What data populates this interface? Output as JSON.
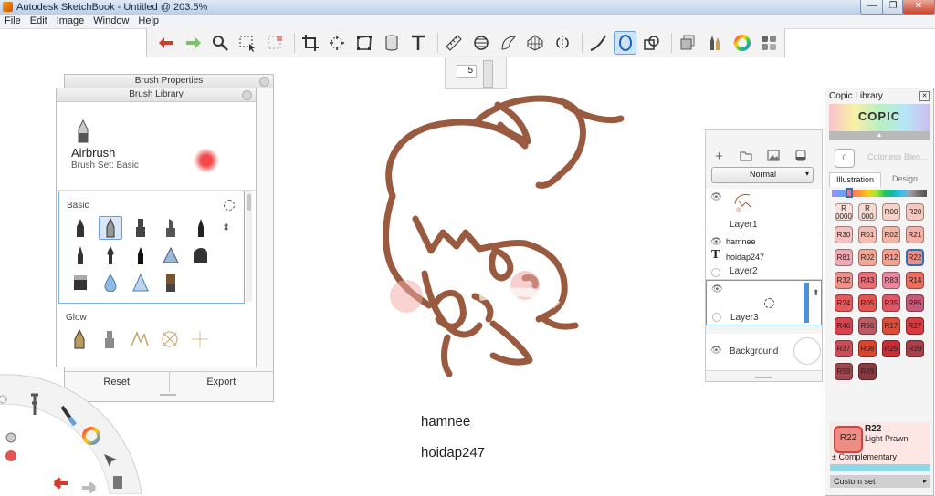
{
  "window": {
    "title": "Autodesk SketchBook - Untitled @ 203.5%",
    "minimize": "—",
    "maximize": "❐",
    "close": "✕"
  },
  "menu": [
    "File",
    "Edit",
    "Image",
    "Window",
    "Help"
  ],
  "toolbar": {
    "brush_size": "5"
  },
  "brush_properties": {
    "title": "Brush Properties",
    "reset_label": "Reset",
    "export_label": "Export"
  },
  "brush_library": {
    "title": "Brush Library",
    "current_brush": "Airbrush",
    "brush_set": "Brush Set: Basic",
    "section_basic": "Basic",
    "section_glow": "Glow"
  },
  "layers": {
    "blend_mode": "Normal",
    "items": [
      {
        "name": "Layer1"
      },
      {
        "name": "Layer2",
        "text_lines": [
          "hamnee",
          "hoidap247"
        ]
      },
      {
        "name": "Layer3"
      },
      {
        "name": "Background"
      }
    ]
  },
  "copic": {
    "title": "Copic Library",
    "logo": "COPIC",
    "colorless_label": "Colorless Blen...",
    "colorless_code": "0",
    "tab_illustration": "Illustration",
    "tab_design": "Design",
    "swatches": [
      {
        "code": "R\n0000",
        "color": "#f7e1d8"
      },
      {
        "code": "R\n000",
        "color": "#f6dad2"
      },
      {
        "code": "R00",
        "color": "#f5d3c8"
      },
      {
        "code": "R20",
        "color": "#f6c8c0"
      },
      {
        "code": "R30",
        "color": "#f5c0bf"
      },
      {
        "code": "R01",
        "color": "#f3bfb2"
      },
      {
        "code": "R02",
        "color": "#f2b6a6"
      },
      {
        "code": "R21",
        "color": "#f3b1a7"
      },
      {
        "code": "R81",
        "color": "#efa9b4"
      },
      {
        "code": "R02",
        "color": "#f0a898"
      },
      {
        "code": "R12",
        "color": "#f2a190"
      },
      {
        "code": "R22",
        "color": "#ef8d85"
      },
      {
        "code": "R32",
        "color": "#ee918b"
      },
      {
        "code": "R43",
        "color": "#ea6f78"
      },
      {
        "code": "R83",
        "color": "#e9889e"
      },
      {
        "code": "R14",
        "color": "#ea6d5f"
      },
      {
        "code": "R24",
        "color": "#e65a5e"
      },
      {
        "code": "R05",
        "color": "#e4534f"
      },
      {
        "code": "R35",
        "color": "#e45667"
      },
      {
        "code": "R85",
        "color": "#c85978"
      },
      {
        "code": "R46",
        "color": "#d84350"
      },
      {
        "code": "R56",
        "color": "#bb5a63"
      },
      {
        "code": "R17",
        "color": "#de4c3a"
      },
      {
        "code": "R27",
        "color": "#d83a3f"
      },
      {
        "code": "R37",
        "color": "#c84d58"
      },
      {
        "code": "R08",
        "color": "#d9452f"
      },
      {
        "code": "R29",
        "color": "#c92e37"
      },
      {
        "code": "R39",
        "color": "#a94049"
      },
      {
        "code": "R59",
        "color": "#a24850"
      },
      {
        "code": "R89",
        "color": "#8c3a42"
      }
    ],
    "selected_code": "R22",
    "selected_name": "Light Prawn",
    "selected_color": "#ef8d85",
    "complementary_label": "Complementary",
    "custom_set_label": "Custom set"
  },
  "canvas": {
    "text_lines": [
      "hamnee",
      "hoidap247"
    ]
  }
}
